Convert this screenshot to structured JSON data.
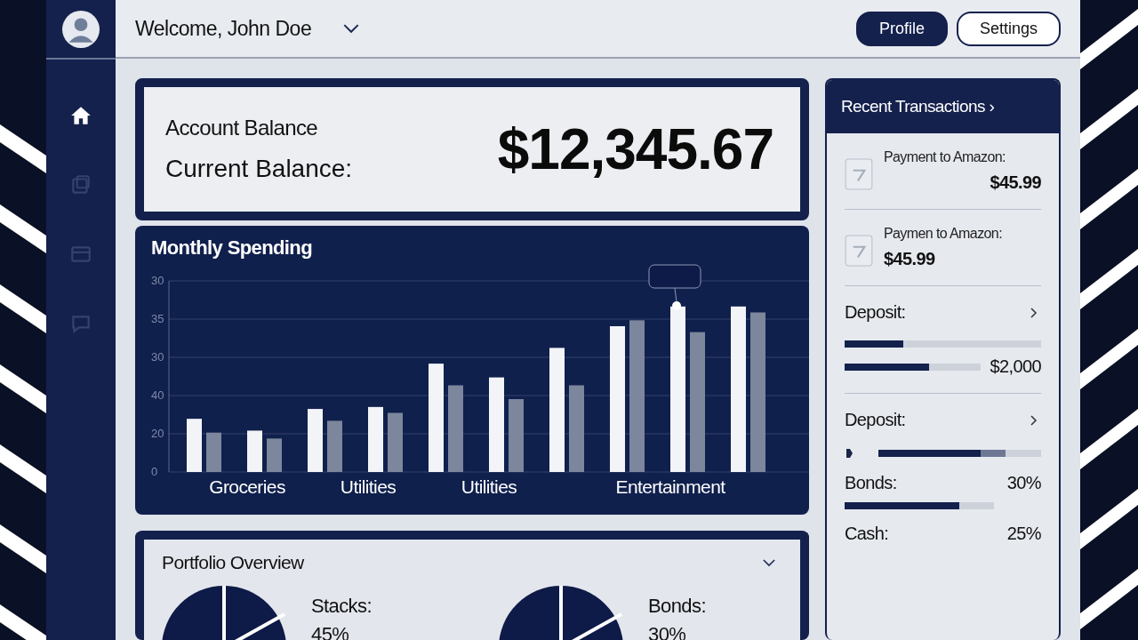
{
  "header": {
    "greeting": "Welcome, John Doe",
    "buttons": [
      {
        "label": "Profile",
        "kind": "primary"
      },
      {
        "label": "Settings",
        "kind": "outline"
      }
    ]
  },
  "sidebar": {
    "items": [
      {
        "selected": true
      },
      {
        "selected": false
      },
      {
        "selected": false
      },
      {
        "selected": false
      }
    ]
  },
  "balance": {
    "title": "Account Balance",
    "label": "Current Balance:",
    "amount": "$12,345.67"
  },
  "monthly_spending": {
    "title": "Monthly Spending",
    "x_labels": [
      "Groceries",
      "Utilities",
      "Utilities",
      "Entertainment"
    ],
    "y_labels": [
      "30",
      "35",
      "30",
      "40",
      "20",
      "0"
    ]
  },
  "portfolio": {
    "title": "Portfolio Overview",
    "items": [
      {
        "label": "Stacks:",
        "value": "45%"
      },
      {
        "label": "Bonds:",
        "value": "30%"
      }
    ]
  },
  "transactions": {
    "title": "Recent Transactions ›",
    "items": [
      {
        "kind": "payment",
        "label": "Payment to Amazon:",
        "amount": "$45.99"
      },
      {
        "kind": "payment",
        "label": "Paymen to Amazon:",
        "amount": "$45.99"
      },
      {
        "kind": "deposit",
        "label": "Deposit:",
        "bars": [
          {
            "level": 0.3
          },
          {
            "level": 0.62
          }
        ],
        "amount": "$2,000"
      },
      {
        "kind": "deposit",
        "label": "Deposit:",
        "bars": [
          {
            "kind": "stacked",
            "segments": [
              {
                "level": 0.63
              },
              {
                "level": 0.78
              }
            ]
          }
        ],
        "rows": [
          {
            "label": "Bonds:",
            "value": "30%",
            "level": 0.77
          },
          {
            "label": "Cash:",
            "value": "25%"
          }
        ]
      }
    ]
  }
}
